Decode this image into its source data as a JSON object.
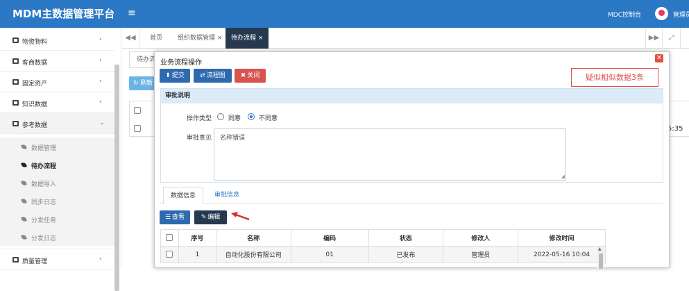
{
  "header": {
    "brand": "MDM主数据管理平台",
    "menu_toggle": "≡",
    "control_link": "MDC控制台",
    "user": "管理员"
  },
  "sidebar": {
    "items": [
      {
        "label": "物资物料",
        "chevron": "‹"
      },
      {
        "label": "客商数据",
        "chevron": "‹"
      },
      {
        "label": "固定资产",
        "chevron": "‹"
      },
      {
        "label": "知识数据",
        "chevron": "‹"
      },
      {
        "label": "参考数据",
        "chevron": "⌄"
      },
      {
        "label": "质量管理",
        "chevron": "‹"
      }
    ],
    "subitems": [
      {
        "label": "数据管理"
      },
      {
        "label": "待办流程"
      },
      {
        "label": "数据导入"
      },
      {
        "label": "同步日志"
      },
      {
        "label": "分发任务"
      },
      {
        "label": "分发日志"
      }
    ]
  },
  "tabs": {
    "prev": "◀◀",
    "next": "▶▶",
    "fullscreen": "⤢",
    "items": [
      {
        "label": "首页"
      },
      {
        "label": "组织数据管理 ×"
      },
      {
        "label": "待办流程 ×"
      }
    ]
  },
  "background": {
    "tab_label": "待办流",
    "refresh_label": "↻ 刷新",
    "time_fragment": "5:35"
  },
  "modal": {
    "title": "业务流程操作",
    "close": "✕",
    "buttons": {
      "submit": "提交",
      "flowchart": "流程图",
      "close": "关闭"
    },
    "similar_notice": "疑似相似数据3条",
    "section_title": "审批说明",
    "op_type_label": "操作类型",
    "op_options": [
      "同意",
      "不同意"
    ],
    "op_selected": "不同意",
    "opinion_label": "审批意见",
    "opinion_value": "名称错误",
    "subtabs": [
      {
        "label": "数据信息"
      },
      {
        "label": "审批信息"
      }
    ],
    "view_button": "查看",
    "edit_button": "编辑",
    "table": {
      "headers": [
        "序号",
        "名称",
        "编码",
        "状态",
        "修改人",
        "修改时间"
      ],
      "rows": [
        [
          "1",
          "自动化股份有限公司",
          "01",
          "已发布",
          "管理员",
          "2022-05-16 10:04"
        ]
      ]
    }
  },
  "colors": {
    "header_bg": "#2b78c5",
    "active_tab_bg": "#26394f",
    "primary_button": "#2d6ab0",
    "danger": "#d9534f",
    "section_header_bg": "#dcebf8"
  }
}
